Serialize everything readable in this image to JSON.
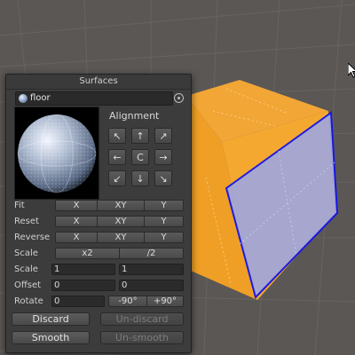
{
  "panel": {
    "title": "Surfaces",
    "material": {
      "name": "floor",
      "icon": "material-sphere-icon"
    },
    "alignment": {
      "label": "Alignment",
      "buttons": {
        "top_left": "↖",
        "top": "↑",
        "top_right": "↗",
        "left": "←",
        "center": "C",
        "right": "→",
        "bottom_left": "↙",
        "bottom": "↓",
        "bottom_right": "↘"
      }
    },
    "fit": {
      "label": "Fit",
      "x": "X",
      "xy": "XY",
      "y": "Y"
    },
    "reset": {
      "label": "Reset",
      "x": "X",
      "xy": "XY",
      "y": "Y"
    },
    "reverse": {
      "label": "Reverse",
      "x": "X",
      "xy": "XY",
      "y": "Y"
    },
    "scale_buttons": {
      "label": "Scale",
      "double": "x2",
      "half": "/2"
    },
    "scale_fields": {
      "label": "Scale",
      "x": "1",
      "y": "1"
    },
    "offset_fields": {
      "label": "Offset",
      "x": "0",
      "y": "0"
    },
    "rotate": {
      "label": "Rotate",
      "value": "0",
      "minus90": "-90°",
      "plus90": "+90°"
    },
    "discard": "Discard",
    "undiscard": "Un-discard",
    "smooth": "Smooth",
    "unsmooth": "Un-smooth"
  },
  "colors": {
    "background": "#5a5654",
    "panel": "#3c3c3c",
    "cube_orange": "#f2a52a",
    "selected_face": "#9aa0d6",
    "selection_edge": "#1616e6"
  }
}
